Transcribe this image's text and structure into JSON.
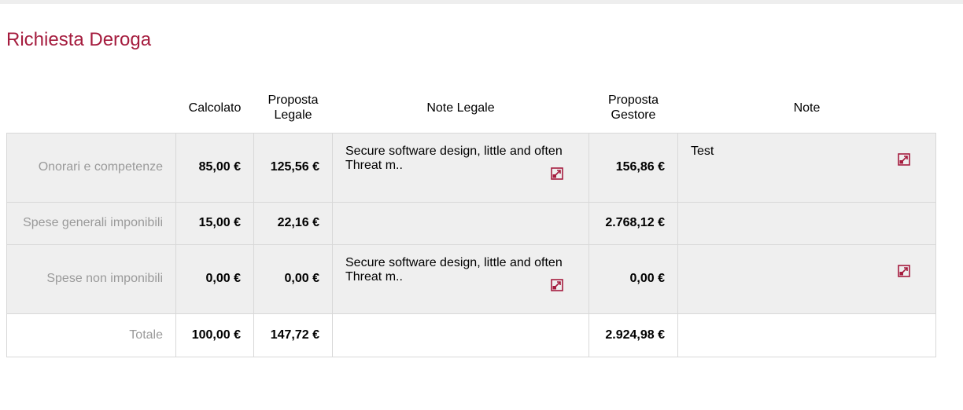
{
  "title": "Richiesta Deroga",
  "columns": {
    "calcolato": "Calcolato",
    "proposta_legale": "Proposta Legale",
    "note_legale": "Note Legale",
    "proposta_gestore": "Proposta Gestore",
    "note": "Note"
  },
  "rows": [
    {
      "label": "Onorari e competenze",
      "calcolato": "85,00 €",
      "proposta_legale": "125,56 €",
      "note_legale": "Secure software design, little and often Threat m..",
      "proposta_gestore": "156,86 €",
      "note": "Test"
    },
    {
      "label": "Spese generali imponibili",
      "calcolato": "15,00 €",
      "proposta_legale": "22,16 €",
      "note_legale": "",
      "proposta_gestore": "2.768,12 €",
      "note": ""
    },
    {
      "label": "Spese non imponibili",
      "calcolato": "0,00 €",
      "proposta_legale": "0,00 €",
      "note_legale": "Secure software design, little and often Threat m..",
      "proposta_gestore": "0,00 €",
      "note": ""
    }
  ],
  "total": {
    "label": "Totale",
    "calcolato": "100,00 €",
    "proposta_legale": "147,72 €",
    "proposta_gestore": "2.924,98 €"
  },
  "icons": {
    "expand": "expand-icon"
  },
  "colors": {
    "accent": "#a51c3e",
    "row_grey": "#efefef",
    "label_grey": "#9a9a9a"
  }
}
